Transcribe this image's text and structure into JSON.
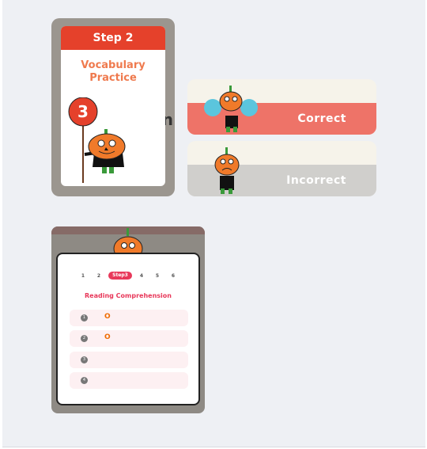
{
  "vocab_card": {
    "step": "Step 2",
    "title_line1": "Vocabulary",
    "title_line2": "Practice",
    "sign_number": "3",
    "background_text": "n"
  },
  "feedback": {
    "correct": "Correct",
    "incorrect": "Incorrect",
    "colors": {
      "correct": "#ee7368",
      "incorrect": "#d0cfcc"
    }
  },
  "reading_card": {
    "steps": [
      "1",
      "2",
      "Step3",
      "4",
      "5",
      "6"
    ],
    "active_step": "Step3",
    "title": "Reading Comprehension",
    "rows": [
      {
        "num": "1",
        "mark": "O"
      },
      {
        "num": "2",
        "mark": "O"
      },
      {
        "num": "3",
        "mark": ""
      },
      {
        "num": "4",
        "mark": ""
      }
    ]
  }
}
